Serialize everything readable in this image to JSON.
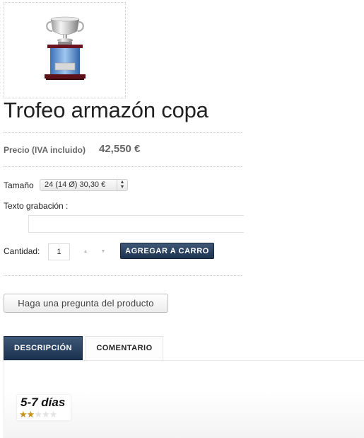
{
  "product": {
    "title": "Trofeo armazón copa",
    "image_icon": "trophy-cup-image"
  },
  "price": {
    "label": "Precio (IVA incluido)",
    "value": "42,550 €"
  },
  "size": {
    "label": "Tamaño",
    "selected": "24 (14 Ø) 30,30 €",
    "spinner_icon": "up-down-arrows-icon"
  },
  "engraving": {
    "label": "Texto grabación :",
    "value": ""
  },
  "quantity": {
    "label": "Cantidad:",
    "value": "1",
    "increment_icon": "triangle-up-icon",
    "decrement_icon": "triangle-down-icon"
  },
  "add_to_cart_label": "AGREGAR A CARRO",
  "ask_question_label": "Haga una pregunta del producto",
  "tabs": [
    {
      "label": "DESCRIPCIÓN",
      "active": true
    },
    {
      "label": "COMENTARIO",
      "active": false
    }
  ],
  "delivery": {
    "text": "5-7 días",
    "rating": 2,
    "max_rating": 5,
    "star_color": "#c8921a"
  },
  "colors": {
    "button_dark": "#1d334f",
    "price_gray": "#666666"
  }
}
